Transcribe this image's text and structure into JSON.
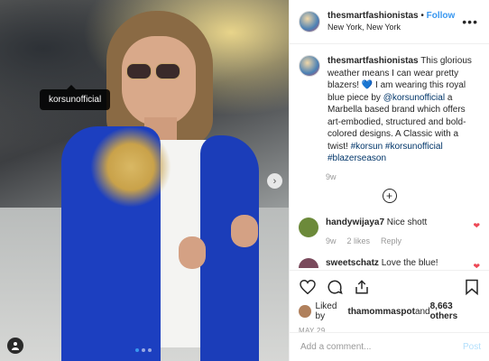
{
  "header": {
    "username": "thesmartfashionistas",
    "separator": " • ",
    "follow_label": "Follow",
    "location": "New York, New York",
    "more_icon": "more-options-icon"
  },
  "photo": {
    "tag_label": "korsunofficial",
    "carousel": {
      "total": 3,
      "active_index": 0
    }
  },
  "caption": {
    "username": "thesmartfashionistas",
    "text_1": " This glorious weather means I can wear pretty blazers! ",
    "heart": "💙",
    "text_2": " I am wearing this royal blue piece by ",
    "mention": "@korsunofficial",
    "text_3": " a Marbella based brand which offers art-embodied, structured and bold-colored designs. A Classic with a twist! ",
    "hashtag_1": "#korsun",
    "hashtag_2": "#korsunofficial",
    "hashtag_3": "#blazerseason",
    "age": "9w"
  },
  "comments": [
    {
      "username": "handywijaya7",
      "text": " Nice shott",
      "age": "9w",
      "likes": "2 likes",
      "reply": "Reply"
    },
    {
      "username": "sweetschatz",
      "text": " Love the blue!"
    }
  ],
  "likes": {
    "prefix": "Liked by ",
    "user": "thamommaspot",
    "middle": " and ",
    "others": "8,663 others"
  },
  "date": "MAY 29",
  "add_comment": {
    "placeholder": "Add a comment...",
    "post_label": "Post"
  },
  "colors": {
    "accent": "#3897f0",
    "heart": "#ed4956",
    "jacket": "#1c3fc0"
  }
}
